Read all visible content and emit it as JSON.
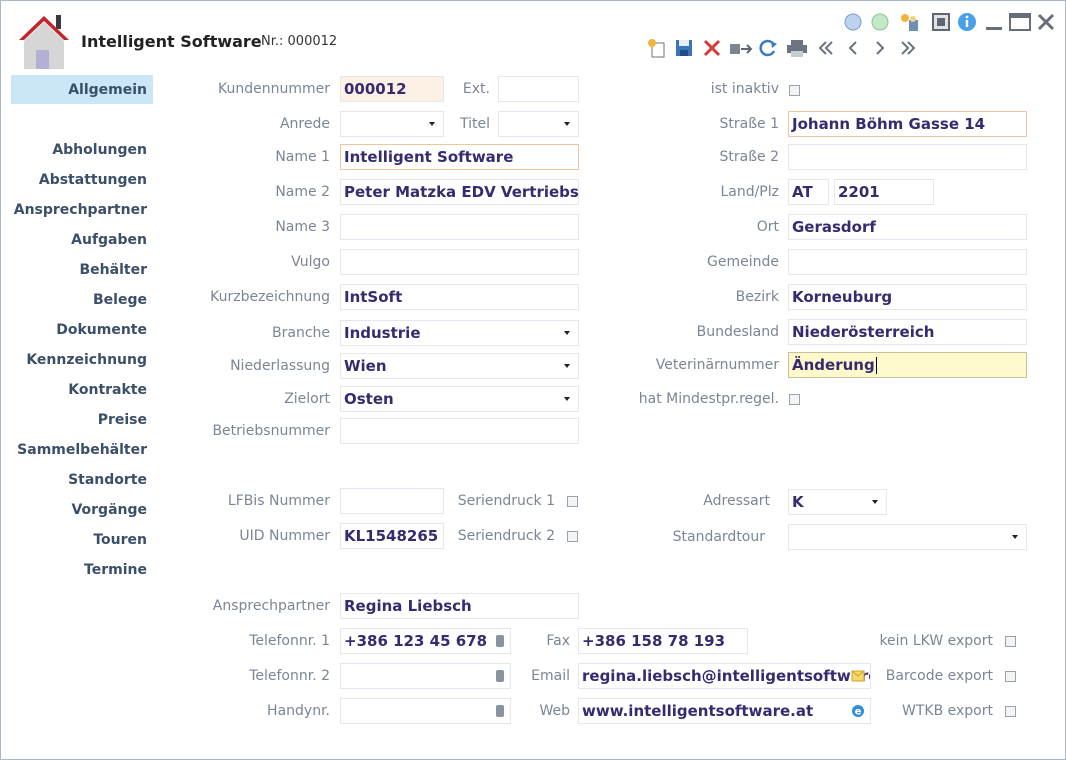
{
  "header": {
    "title": "Intelligent Software",
    "nr_label": "Nr.: 000012"
  },
  "icons": {
    "home": "home-icon",
    "circle_blue": "circle-blue-icon",
    "circle_green": "circle-green-icon",
    "new_user": "new-user-icon",
    "restore": "restore-icon",
    "info": "info-icon",
    "minimize": "minimize-icon",
    "maximize": "maximize-icon",
    "close": "close-icon",
    "new_doc": "new-document-icon",
    "save": "save-icon",
    "delete": "delete-icon",
    "transfer": "transfer-icon",
    "refresh": "refresh-icon",
    "print": "print-icon",
    "first": "first-icon",
    "prev": "prev-icon",
    "next": "next-icon",
    "last": "last-icon"
  },
  "colors": {
    "accent": "#cbe6f7",
    "nav_text": "#3c4f69",
    "value_text": "#372a6e",
    "label_text": "#7a8596",
    "highlight_border": "#f0c49c",
    "focus_bg": "#fdf9cb"
  },
  "nav": {
    "active": "Allgemein",
    "items": [
      "Abholungen",
      "Abstattungen",
      "Ansprechpartner",
      "Aufgaben",
      "Behälter",
      "Belege",
      "Dokumente",
      "Kennzeichnung",
      "Kontrakte",
      "Preise",
      "Sammelbehälter",
      "Standorte",
      "Vorgänge",
      "Touren",
      "Termine"
    ]
  },
  "labels": {
    "kundennummer": "Kundennummer",
    "ext": "Ext.",
    "anrede": "Anrede",
    "titel": "Titel",
    "name1": "Name 1",
    "name2": "Name 2",
    "name3": "Name 3",
    "vulgo": "Vulgo",
    "kurzbezeichnung": "Kurzbezeichnung",
    "branche": "Branche",
    "niederlassung": "Niederlassung",
    "zielort": "Zielort",
    "betriebsnummer": "Betriebsnummer",
    "ist_inaktiv": "ist inaktiv",
    "strasse1": "Straße 1",
    "strasse2": "Straße 2",
    "land_plz": "Land/Plz",
    "ort": "Ort",
    "gemeinde": "Gemeinde",
    "bezirk": "Bezirk",
    "bundesland": "Bundesland",
    "veterinaernummer": "Veterinärnummer",
    "mindestpr": "hat Mindestpr.regel.",
    "lfbis": "LFBis Nummer",
    "uid": "UID Nummer",
    "seriendruck1": "Seriendruck 1",
    "seriendruck2": "Seriendruck 2",
    "adressart": "Adressart",
    "standardtour": "Standardtour",
    "ansprechpartner": "Ansprechpartner",
    "telefon1": "Telefonnr. 1",
    "telefon2": "Telefonnr. 2",
    "handy": "Handynr.",
    "fax": "Fax",
    "email": "Email",
    "web": "Web",
    "kein_lkw": "kein LKW export",
    "barcode": "Barcode export",
    "wtkb": "WTKB export"
  },
  "values": {
    "kundennummer": "000012",
    "ext": "",
    "anrede": "",
    "titel": "",
    "name1": "Intelligent Software",
    "name2": "Peter Matzka EDV Vertriebs KG",
    "name3": "",
    "vulgo": "",
    "kurzbezeichnung": "IntSoft",
    "branche": "Industrie",
    "niederlassung": "Wien",
    "zielort": "Osten",
    "betriebsnummer": "",
    "strasse1": "Johann Böhm Gasse 14",
    "strasse2": "",
    "land": "AT",
    "plz": "2201",
    "ort": "Gerasdorf",
    "gemeinde": "",
    "bezirk": "Korneuburg",
    "bundesland": "Niederösterreich",
    "veterinaernummer": "Änderung",
    "lfbis": "",
    "uid": "KL1548265",
    "adressart": "K",
    "standardtour": "",
    "ansprechpartner": "Regina Liebsch",
    "telefon1": "+386 123 45 678",
    "telefon2": "",
    "handy": "",
    "fax": "+386 158  78 193",
    "email": "regina.liebsch@intelligentsoftware",
    "web": "www.intelligentsoftware.at"
  },
  "checkboxes": {
    "ist_inaktiv": false,
    "mindestpr": false,
    "seriendruck1": false,
    "seriendruck2": false,
    "kein_lkw": false,
    "barcode": false,
    "wtkb": false
  }
}
